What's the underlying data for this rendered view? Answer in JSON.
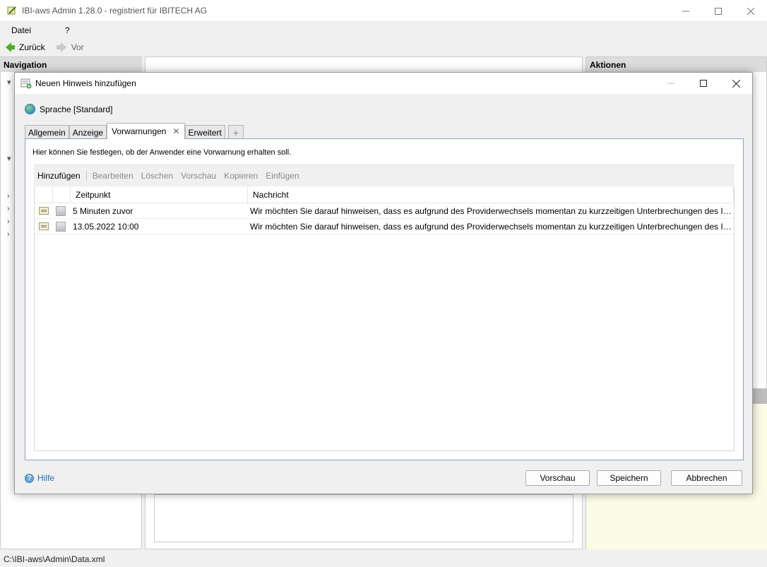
{
  "app": {
    "title": "IBI-aws Admin 1.28.0 - registriert für IBITECH AG",
    "menu": [
      "Datei",
      "?"
    ],
    "nav": {
      "back": "Zurück",
      "forward": "Vor"
    },
    "panes": {
      "navigation": "Navigation",
      "actions": "Aktionen"
    },
    "status": "C:\\IBI-aws\\Admin\\Data.xml",
    "icons": {
      "minimize": "minimize-icon",
      "maximize": "maximize-icon",
      "close": "close-icon"
    }
  },
  "dialog": {
    "title": "Neuen Hinweis hinzufügen",
    "language": "Sprache [Standard]",
    "tabs": [
      "Allgemein",
      "Anzeige",
      "Vorwarnungen",
      "Erweitert"
    ],
    "active_tab": "Vorwarnungen",
    "tab_add": "+",
    "tab_close": "✕",
    "description": "Hier können Sie festlegen, ob der Anwender eine Vorwarnung erhalten soll.",
    "toolbar": [
      "Hinzufügen",
      "Bearbeiten",
      "Löschen",
      "Vorschau",
      "Kopieren",
      "Einfügen"
    ],
    "columns": {
      "time": "Zeitpunkt",
      "message": "Nachricht"
    },
    "rows": [
      {
        "time": "5 Minuten zuvor",
        "message": "Wir möchten Sie darauf hinweisen, dass es aufgrund des Providerwechsels momentan zu kurzzeitigen Unterbrechungen des Internetzugangs kommen kann."
      },
      {
        "time": "13.05.2022 10:00",
        "message": "Wir möchten Sie darauf hinweisen, dass es aufgrund des Providerwechsels momentan zu kurzzeitigen Unterbrechungen des Internetzugangs kommen kann."
      }
    ],
    "help": "Hilfe",
    "buttons": {
      "preview": "Vorschau",
      "save": "Speichern",
      "cancel": "Abbrechen"
    }
  }
}
